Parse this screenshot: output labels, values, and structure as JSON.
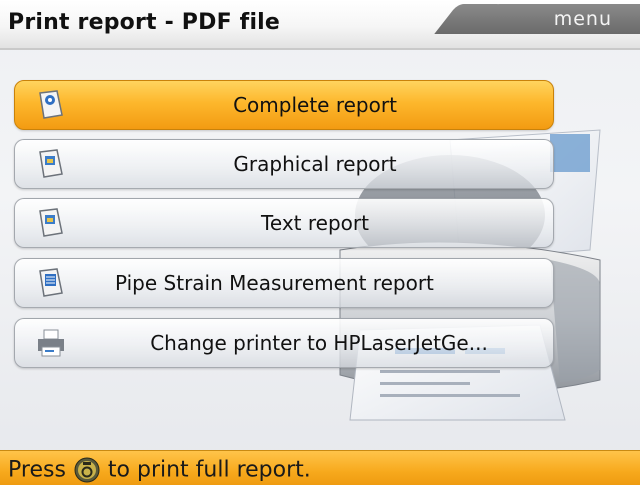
{
  "header": {
    "title": "Print report - PDF file",
    "menu_label": "menu"
  },
  "menu": {
    "items": [
      {
        "label": "Complete report",
        "icon": "complete-report-icon",
        "selected": true
      },
      {
        "label": "Graphical report",
        "icon": "graphical-report-icon",
        "selected": false
      },
      {
        "label": "Text report",
        "icon": "text-report-icon",
        "selected": false
      },
      {
        "label": "Pipe Strain Measurement report",
        "icon": "pipe-strain-report-icon",
        "selected": false
      },
      {
        "label": "Change printer to HPLaserJetGe...",
        "icon": "printer-icon",
        "selected": false
      }
    ]
  },
  "status": {
    "prefix": "Press",
    "key_icon": "enter-key-icon",
    "suffix": "to print full report."
  },
  "colors": {
    "accent": "#f7a91c",
    "selected_row": "#fdb72c",
    "menu_tab": "#7a7a7a"
  }
}
